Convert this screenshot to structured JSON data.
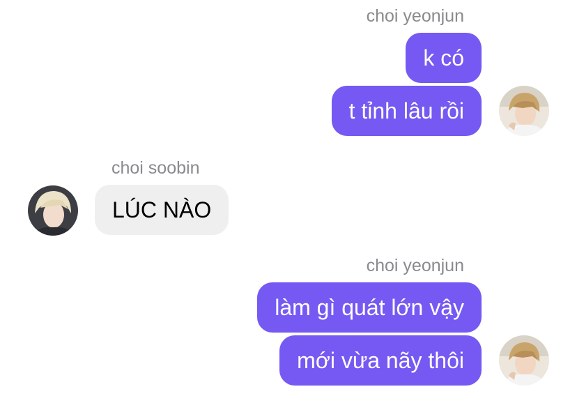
{
  "messages": [
    {
      "sender": "choi yeonjun",
      "side": "right",
      "bubbles": [
        "k có",
        "t tỉnh lâu rồi"
      ]
    },
    {
      "sender": "choi soobin",
      "side": "left",
      "bubbles": [
        "LÚC NÀO"
      ]
    },
    {
      "sender": "choi yeonjun",
      "side": "right",
      "bubbles": [
        "làm gì quát lớn vậy",
        "mới vừa nãy thôi"
      ]
    }
  ],
  "colors": {
    "sent_bubble": "#7559f2",
    "received_bubble": "#efefef",
    "sender_name": "#8a8a8e"
  },
  "avatars": {
    "yeonjun": "profile-photo-icon",
    "soobin": "profile-photo-icon"
  }
}
